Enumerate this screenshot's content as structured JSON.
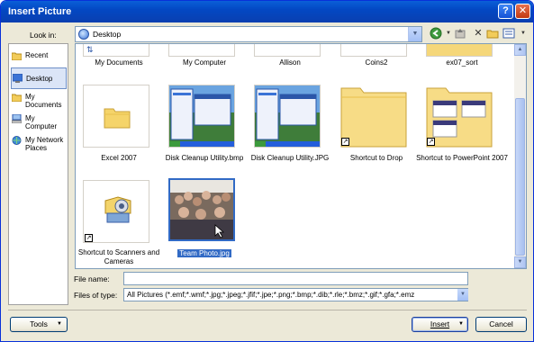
{
  "window": {
    "title": "Insert Picture",
    "help_glyph": "?",
    "close_glyph": "✕"
  },
  "toolbar": {
    "look_in_label": "Look in:",
    "look_in_value": "Desktop",
    "back_icon": "back-arrow-icon",
    "up_icon": "up-folder-icon",
    "delete_icon": "delete-icon",
    "new_folder_icon": "new-folder-icon",
    "views_icon": "views-icon"
  },
  "places": [
    {
      "label": "Recent",
      "icon": "recent-icon"
    },
    {
      "label": "Desktop",
      "icon": "desktop-icon",
      "selected": true
    },
    {
      "label": "My Documents",
      "icon": "my-documents-icon"
    },
    {
      "label": "My Computer",
      "icon": "my-computer-icon"
    },
    {
      "label": "My Network Places",
      "icon": "network-places-icon"
    }
  ],
  "files": {
    "top_row": [
      "My Documents",
      "My Computer",
      "Allison",
      "Coins2",
      "ex07_sort"
    ],
    "row2": [
      {
        "label": "Excel 2007",
        "kind": "folder"
      },
      {
        "label": "Disk Cleanup Utility.bmp",
        "kind": "screenshot"
      },
      {
        "label": "Disk Cleanup Utility.JPG",
        "kind": "screenshot"
      },
      {
        "label": "Shortcut to  Drop",
        "kind": "folder-shortcut"
      },
      {
        "label": "Shortcut to PowerPoint 2007",
        "kind": "folder-shortcut-thumbs"
      }
    ],
    "row3": [
      {
        "label": "Shortcut to Scanners and Cameras",
        "kind": "scanner-shortcut"
      },
      {
        "label": "Team Photo.jpg",
        "kind": "photo",
        "selected": true
      }
    ]
  },
  "form": {
    "file_name_label": "File name:",
    "file_name_value": "",
    "files_of_type_label": "Files of type:",
    "files_of_type_value": "All Pictures (*.emf;*.wmf;*.jpg;*.jpeg;*.jfif;*.jpe;*.png;*.bmp;*.dib;*.rle;*.bmz;*.gif;*.gfa;*.emz"
  },
  "buttons": {
    "tools": "Tools",
    "insert": "Insert",
    "cancel": "Cancel"
  },
  "colors": {
    "title_bar": "#0348c3",
    "selection": "#316ac5",
    "dialog_bg": "#ece9d8"
  }
}
